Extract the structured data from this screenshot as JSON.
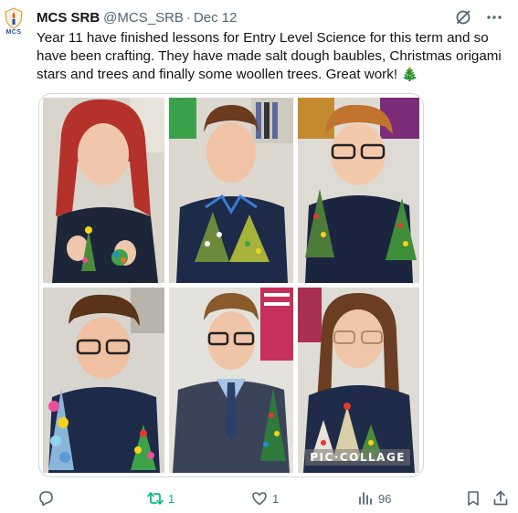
{
  "account": {
    "avatar_icon": "school-crest-icon",
    "avatar_text": "MCS",
    "name": "MCS SRB",
    "handle": "@MCS_SRB",
    "separator": "·",
    "date": "Dec 12"
  },
  "header_icons": [
    "grok-icon",
    "more-icon"
  ],
  "body": "Year 11 have finished lessons for Entry Level Science for this term and so have been crafting. They have made salt dough baubles, Christmas origami stars and trees and finally some woollen trees. Great work! 🎄",
  "media": {
    "watermark": "PIC·COLLAGE",
    "photo_count": 6
  },
  "actions": {
    "reply": {
      "icon": "reply-icon",
      "count": ""
    },
    "retweet": {
      "icon": "retweet-icon",
      "count": "1"
    },
    "like": {
      "icon": "heart-icon",
      "count": "1"
    },
    "views": {
      "icon": "views-icon",
      "count": "96"
    },
    "bookmark": {
      "icon": "bookmark-icon"
    },
    "share": {
      "icon": "share-icon"
    }
  },
  "colors": {
    "text": "#0f1419",
    "muted": "#536471",
    "retweet_active": "#00ba7c",
    "uniform_navy": "#1f2b45",
    "border": "#cfd9de"
  }
}
